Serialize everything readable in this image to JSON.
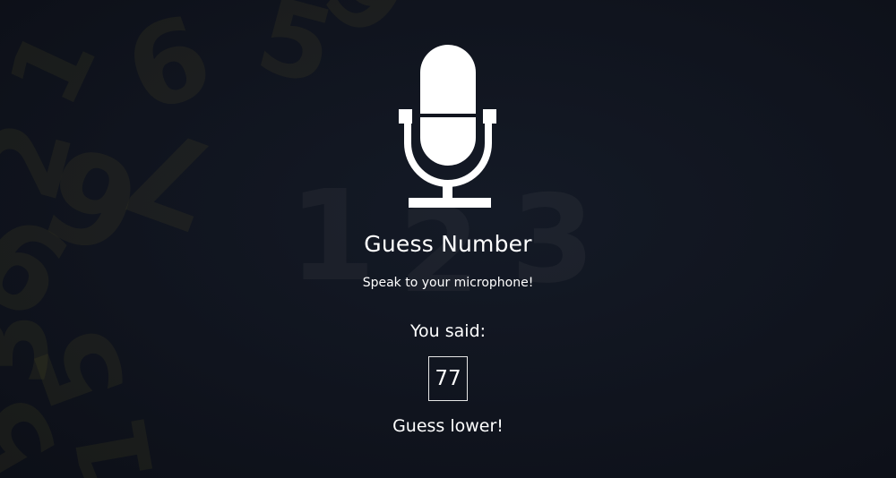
{
  "app": {
    "title": "Guess Number",
    "instruction": "Speak to your microphone!"
  },
  "result": {
    "label": "You said:",
    "spoken_value": "77",
    "feedback": "Guess lower!"
  },
  "background": {
    "digits_left": [
      "1",
      "6",
      "5",
      "9",
      "2",
      "6",
      "7",
      "9",
      "5",
      "1",
      "3",
      "5"
    ],
    "digits_center": [
      "1",
      "2",
      "3"
    ]
  },
  "icons": {
    "main": "microphone-icon"
  },
  "colors": {
    "background": "#10141e",
    "text": "#ffffff",
    "background_digits": "#5f5528"
  }
}
